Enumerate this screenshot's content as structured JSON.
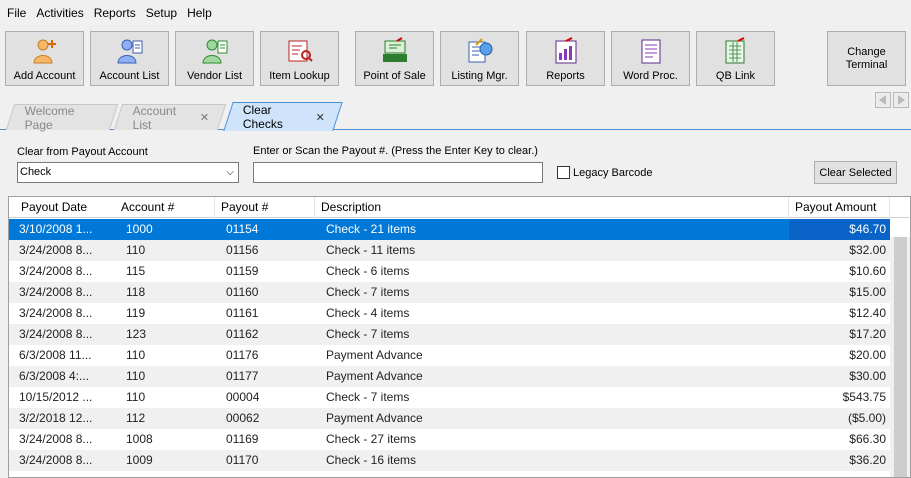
{
  "menu": [
    "File",
    "Activities",
    "Reports",
    "Setup",
    "Help"
  ],
  "toolbar": {
    "buttons": [
      {
        "label": "Add Account",
        "icon": "add-account-icon"
      },
      {
        "label": "Account List",
        "icon": "account-list-icon"
      },
      {
        "label": "Vendor List",
        "icon": "vendor-list-icon"
      },
      {
        "label": "Item Lookup",
        "icon": "item-lookup-icon"
      },
      {
        "label": "Point of Sale",
        "icon": "point-of-sale-icon"
      },
      {
        "label": "Listing Mgr.",
        "icon": "listing-manager-icon"
      },
      {
        "label": "Reports",
        "icon": "reports-icon"
      },
      {
        "label": "Word Proc.",
        "icon": "word-processor-icon"
      },
      {
        "label": "QB Link",
        "icon": "qb-link-icon"
      }
    ],
    "change_terminal": "Change Terminal"
  },
  "tabs": [
    {
      "label": "Welcome Page",
      "closable": false
    },
    {
      "label": "Account List",
      "closable": true
    },
    {
      "label": "Clear Checks",
      "closable": true,
      "active": true
    }
  ],
  "form": {
    "payout_account_label": "Clear from Payout Account",
    "payout_account_value": "Check",
    "scan_label": "Enter or Scan the Payout #.  (Press the Enter Key to clear.)",
    "scan_value": "",
    "legacy_barcode_label": "Legacy Barcode",
    "legacy_barcode_checked": false,
    "clear_selected": "Clear Selected"
  },
  "table": {
    "columns": [
      "Payout Date",
      "Account #",
      "Payout #",
      "Description",
      "Payout Amount"
    ],
    "rows": [
      {
        "date": "3/10/2008 1...",
        "account": "1000",
        "payout": "01154",
        "desc": "Check - 21 items",
        "amount": "$46.70",
        "selected": true
      },
      {
        "date": "3/24/2008 8...",
        "account": "110",
        "payout": "01156",
        "desc": "Check - 11 items",
        "amount": "$32.00"
      },
      {
        "date": "3/24/2008 8...",
        "account": "115",
        "payout": "01159",
        "desc": "Check - 6 items",
        "amount": "$10.60"
      },
      {
        "date": "3/24/2008 8...",
        "account": "118",
        "payout": "01160",
        "desc": "Check - 7 items",
        "amount": "$15.00"
      },
      {
        "date": "3/24/2008 8...",
        "account": "119",
        "payout": "01161",
        "desc": "Check - 4 items",
        "amount": "$12.40"
      },
      {
        "date": "3/24/2008 8...",
        "account": "123",
        "payout": "01162",
        "desc": "Check - 7 items",
        "amount": "$17.20"
      },
      {
        "date": "6/3/2008 11...",
        "account": "110",
        "payout": "01176",
        "desc": "Payment Advance",
        "amount": "$20.00"
      },
      {
        "date": "6/3/2008 4:...",
        "account": "110",
        "payout": "01177",
        "desc": "Payment Advance",
        "amount": "$30.00"
      },
      {
        "date": "10/15/2012 ...",
        "account": "110",
        "payout": "00004",
        "desc": "Check - 7 items",
        "amount": "$543.75"
      },
      {
        "date": "3/2/2018 12...",
        "account": "112",
        "payout": "00062",
        "desc": "Payment Advance",
        "amount": "($5.00)"
      },
      {
        "date": "3/24/2008 8...",
        "account": "1008",
        "payout": "01169",
        "desc": "Check - 27 items",
        "amount": "$66.30"
      },
      {
        "date": "3/24/2008 8...",
        "account": "1009",
        "payout": "01170",
        "desc": "Check - 16 items",
        "amount": "$36.20"
      }
    ]
  },
  "colors": {
    "selection": "#0078d7",
    "tab_active": "#cfe4fb",
    "tab_border": "#4a90d9"
  }
}
